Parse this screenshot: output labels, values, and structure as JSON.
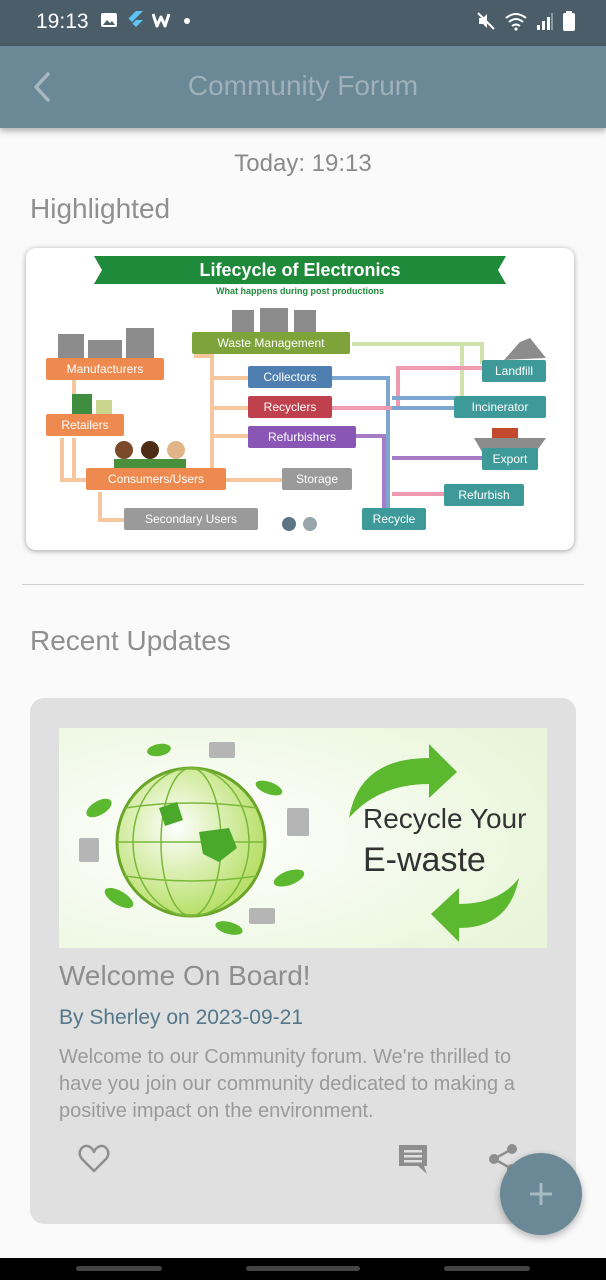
{
  "status_bar": {
    "time": "19:13",
    "icons": [
      "image-icon",
      "flutter-icon",
      "w-app-icon",
      "dot-icon",
      "mute-icon",
      "wifi-icon",
      "signal-icon",
      "battery-icon"
    ]
  },
  "app_bar": {
    "title": "Community Forum",
    "back_icon": "back-arrow-icon"
  },
  "today_label": "Today: 19:13",
  "highlighted": {
    "heading": "Highlighted",
    "slide": {
      "title": "Lifecycle of Electronics",
      "subtitle": "What happens during post productions",
      "nodes": {
        "waste_management": "Waste Management",
        "manufacturers": "Manufacturers",
        "retailers": "Retailers",
        "consumers": "Consumers/Users",
        "secondary": "Secondary Users",
        "storage": "Storage",
        "collectors": "Collectors",
        "recyclers": "Recyclers",
        "refurbishers": "Refurbishers",
        "landfill": "Landfill",
        "incinerator": "Incinerator",
        "export": "Export",
        "refurbish": "Refurbish",
        "recycle": "Recycle"
      }
    },
    "pager": {
      "count": 2,
      "active": 1
    }
  },
  "recent_updates": {
    "heading": "Recent Updates",
    "posts": [
      {
        "image_text_line1": "Recycle Your",
        "image_text_line2": "E-waste",
        "title": "Welcome On Board!",
        "author_line": "By Sherley on 2023-09-21",
        "body": "Welcome to our Community forum. We're thrilled to have you join our community dedicated to making a positive impact on the environment.",
        "actions": [
          "heart-icon",
          "comment-icon",
          "share-icon"
        ]
      }
    ]
  },
  "fab_icon": "plus-icon",
  "colors": {
    "status_bar": "#4a5d68",
    "app_bar": "#6b8896",
    "accent_text": "#55778a",
    "card_bg": "#e0e0e0"
  }
}
